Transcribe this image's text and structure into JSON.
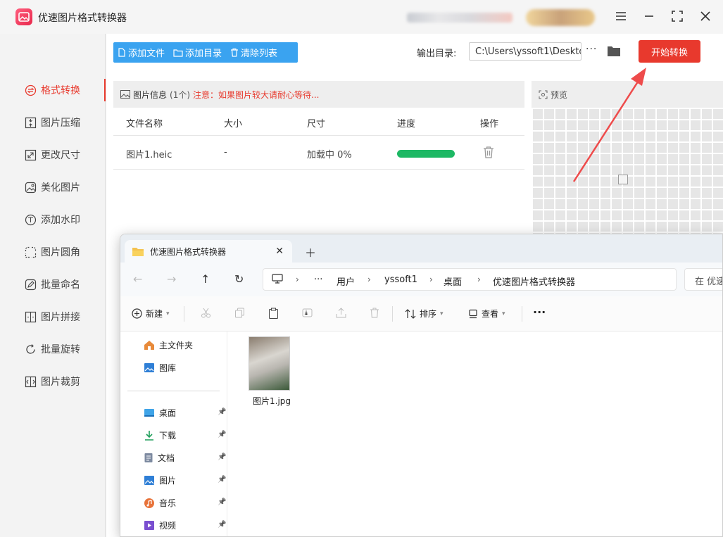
{
  "app": {
    "title": "优速图片格式转换器"
  },
  "sidebar": {
    "items": [
      {
        "label": "格式转换",
        "icon": "format-convert-icon",
        "active": true
      },
      {
        "label": "图片压缩",
        "icon": "compress-icon"
      },
      {
        "label": "更改尺寸",
        "icon": "resize-icon"
      },
      {
        "label": "美化图片",
        "icon": "beautify-icon"
      },
      {
        "label": "添加水印",
        "icon": "watermark-icon"
      },
      {
        "label": "图片圆角",
        "icon": "round-corner-icon"
      },
      {
        "label": "批量命名",
        "icon": "rename-icon"
      },
      {
        "label": "图片拼接",
        "icon": "stitch-icon"
      },
      {
        "label": "批量旋转",
        "icon": "rotate-icon"
      },
      {
        "label": "图片裁剪",
        "icon": "crop-icon"
      }
    ]
  },
  "toolbar": {
    "add_file": "添加文件",
    "add_dir": "添加目录",
    "clear_list": "清除列表"
  },
  "output": {
    "label": "输出目录:",
    "path": "C:\\Users\\yssoft1\\Deskto",
    "more": "···"
  },
  "start_button": "开始转换",
  "info": {
    "title": "图片信息",
    "count": "(1个)",
    "note": "注意：如果图片较大请耐心等待..."
  },
  "table": {
    "headers": [
      "文件名称",
      "大小",
      "尺寸",
      "进度",
      "操作"
    ],
    "rows": [
      {
        "name": "图片1.heic",
        "size": "-",
        "dims": "加载中 0%",
        "progress": 1.0
      }
    ]
  },
  "preview": {
    "title": "预览"
  },
  "explorer": {
    "tab_title": "优速图片格式转换器",
    "breadcrumb": [
      "···",
      "用户",
      "yssoft1",
      "桌面",
      "优速图片格式转换器"
    ],
    "search_placeholder": "在 优速",
    "commands": {
      "new": "新建",
      "sort": "排序",
      "view": "查看",
      "more": "···"
    },
    "nav_top": [
      {
        "label": "主文件夹",
        "icon": "home-icon"
      },
      {
        "label": "图库",
        "icon": "gallery-icon"
      }
    ],
    "nav_pinned": [
      {
        "label": "桌面",
        "icon": "desktop-icon"
      },
      {
        "label": "下载",
        "icon": "download-icon"
      },
      {
        "label": "文档",
        "icon": "document-icon"
      },
      {
        "label": "图片",
        "icon": "pictures-icon"
      },
      {
        "label": "音乐",
        "icon": "music-icon"
      },
      {
        "label": "视频",
        "icon": "video-icon"
      }
    ],
    "files": [
      {
        "name": "图片1.jpg"
      }
    ]
  },
  "colors": {
    "accent": "#e8392d",
    "toolbar": "#3aa3f0",
    "progress": "#1db864"
  }
}
